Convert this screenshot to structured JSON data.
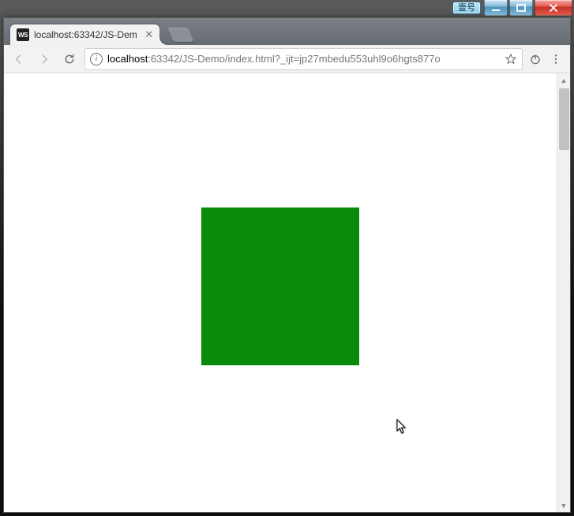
{
  "window": {
    "profile_label": "壹号"
  },
  "tab": {
    "favicon_text": "WS",
    "title": "localhost:63342/JS-Dem"
  },
  "address": {
    "host": "localhost",
    "path": ":63342/JS-Demo/index.html?_ijt=jp27mbedu553uhl9o6hgts877o"
  },
  "content": {
    "box_color": "#0a8a0a"
  }
}
